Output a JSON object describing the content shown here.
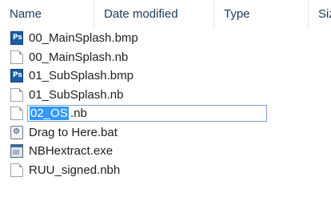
{
  "columns": {
    "name": "Name",
    "date_modified": "Date modified",
    "type": "Type",
    "size": "Siz"
  },
  "files": [
    {
      "name": "00_MainSplash.bmp",
      "icon": "photoshop-file-icon"
    },
    {
      "name": "00_MainSplash.nb",
      "icon": "document-icon"
    },
    {
      "name": "01_SubSplash.bmp",
      "icon": "photoshop-file-icon"
    },
    {
      "name": "01_SubSplash.nb",
      "icon": "document-icon"
    },
    {
      "name": "02_OS.nb",
      "icon": "document-icon",
      "rename": {
        "selected": "02_OS",
        "rest": ".nb"
      }
    },
    {
      "name": "Drag to Here.bat",
      "icon": "batch-file-icon"
    },
    {
      "name": "NBHextract.exe",
      "icon": "executable-icon"
    },
    {
      "name": "RUU_signed.nbh",
      "icon": "document-icon"
    }
  ],
  "icon_glyphs": {
    "photoshop": "Ps",
    "batch": "⚙"
  },
  "colors": {
    "selection": "#3399ff",
    "rename_border": "#7da2ce",
    "header_text": "#1e3a57"
  }
}
